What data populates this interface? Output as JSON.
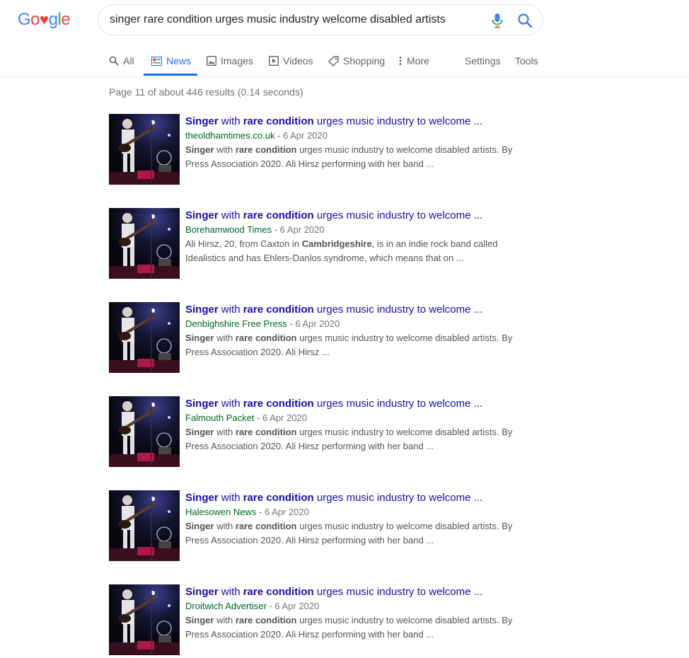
{
  "header": {
    "logo_letters": [
      "G",
      "o",
      "o",
      "g",
      "l",
      "e"
    ],
    "query": "singer rare condition urges music industry welcome disabled artists",
    "icons": {
      "mic": "mic-icon",
      "search": "search-icon"
    }
  },
  "tabs": {
    "all": "All",
    "news": "News",
    "images": "Images",
    "videos": "Videos",
    "shopping": "Shopping",
    "more": "More",
    "settings": "Settings",
    "tools": "Tools",
    "active": "News"
  },
  "stats": "Page 11 of about 446 results (0.14 seconds)",
  "colors": {
    "link": "#1a0dab",
    "source": "#006621",
    "accent": "#1a73e8",
    "muted": "#70757a"
  },
  "results": [
    {
      "title_b1": "Singer",
      "title_t1": " with ",
      "title_b2": "rare condition",
      "title_t2": " urges music industry to welcome ...",
      "source": "theoldhamtimes.co.uk",
      "date": " - 6 Apr 2020",
      "snip_b1": "Singer",
      "snip_t1": " with ",
      "snip_b2": "rare condition",
      "snip_t2": " urges music industry to welcome disabled artists. By Press Association 2020. Ali Hirsz performing with her band ..."
    },
    {
      "title_b1": "Singer",
      "title_t1": " with ",
      "title_b2": "rare condition",
      "title_t2": " urges music industry to welcome ...",
      "source": "Borehamwood Times",
      "date": " - 6 Apr 2020",
      "snip_b1": "",
      "snip_t1": "Ali Hirsz, 20, from Caxton in ",
      "snip_b2": "Cambridgeshire",
      "snip_t2": ", is in an indie rock band called Idealistics and has Ehlers-Danlos syndrome, which means that on ..."
    },
    {
      "title_b1": "Singer",
      "title_t1": " with ",
      "title_b2": "rare condition",
      "title_t2": " urges music industry to welcome ...",
      "source": "Denbighshire Free Press",
      "date": " - 6 Apr 2020",
      "snip_b1": "Singer",
      "snip_t1": " with ",
      "snip_b2": "rare condition",
      "snip_t2": " urges music industry to welcome disabled artists. By Press Association 2020. Ali Hirsz ..."
    },
    {
      "title_b1": "Singer",
      "title_t1": " with ",
      "title_b2": "rare condition",
      "title_t2": " urges music industry to welcome ...",
      "source": "Falmouth Packet",
      "date": " - 6 Apr 2020",
      "snip_b1": "Singer",
      "snip_t1": " with ",
      "snip_b2": "rare condition",
      "snip_t2": " urges music industry to welcome disabled artists. By Press Association 2020. Ali Hirsz performing with her band ..."
    },
    {
      "title_b1": "Singer",
      "title_t1": " with ",
      "title_b2": "rare condition",
      "title_t2": " urges music industry to welcome ...",
      "source": "Halesowen News",
      "date": " - 6 Apr 2020",
      "snip_b1": "Singer",
      "snip_t1": " with ",
      "snip_b2": "rare condition",
      "snip_t2": " urges music industry to welcome disabled artists. By Press Association 2020. Ali Hirsz performing with her band ..."
    },
    {
      "title_b1": "Singer",
      "title_t1": " with ",
      "title_b2": "rare condition",
      "title_t2": " urges music industry to welcome ...",
      "source": "Droitwich Advertiser",
      "date": " - 6 Apr 2020",
      "snip_b1": "Singer",
      "snip_t1": " with ",
      "snip_b2": "rare condition",
      "snip_t2": " urges music industry to welcome disabled artists. By Press Association 2020. Ali Hirsz performing with her band ..."
    }
  ]
}
